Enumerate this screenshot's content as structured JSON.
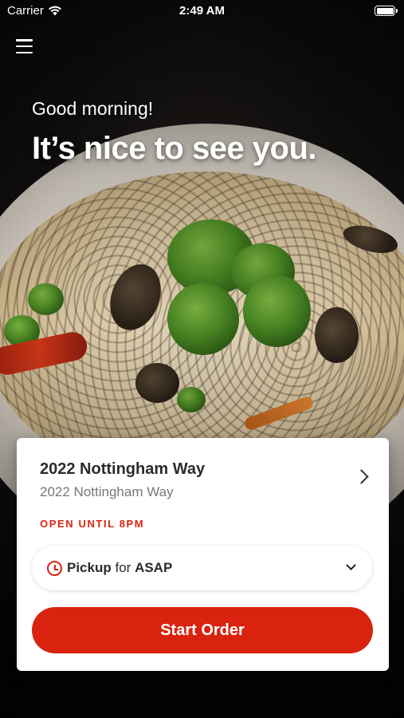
{
  "status_bar": {
    "carrier": "Carrier",
    "time": "2:49 AM",
    "icons": [
      "wifi-icon",
      "battery-icon"
    ]
  },
  "header": {
    "menu_icon": "hamburger-menu-icon",
    "greeting": "Good morning!",
    "headline": "It’s nice to see you."
  },
  "location_card": {
    "name": "2022 Nottingham Way",
    "address": "2022 Nottingham Way",
    "hours": "OPEN UNTIL 8PM",
    "pickup": {
      "mode": "Pickup",
      "connector": "for",
      "time": "ASAP",
      "icon": "clock-icon"
    },
    "start_order_label": "Start Order"
  },
  "colors": {
    "accent": "#d9230f",
    "card_bg": "#ffffff",
    "text_primary": "#2b2b2b",
    "text_secondary": "#777777"
  }
}
